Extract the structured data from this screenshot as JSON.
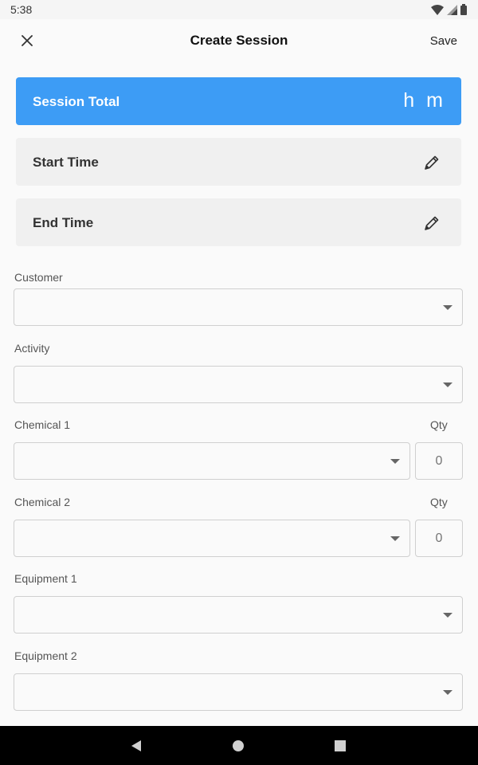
{
  "status": {
    "time": "5:38"
  },
  "appbar": {
    "title": "Create Session",
    "save_label": "Save"
  },
  "session_total": {
    "label": "Session Total",
    "hours_unit": "h",
    "minutes_unit": "m"
  },
  "start_time": {
    "label": "Start Time"
  },
  "end_time": {
    "label": "End Time"
  },
  "fields": {
    "customer": {
      "label": "Customer",
      "value": ""
    },
    "activity": {
      "label": "Activity",
      "value": ""
    },
    "chemical1": {
      "label": "Chemical 1",
      "value": "",
      "qty_label": "Qty",
      "qty_placeholder": "0"
    },
    "chemical2": {
      "label": "Chemical 2",
      "value": "",
      "qty_label": "Qty",
      "qty_placeholder": "0"
    },
    "equipment1": {
      "label": "Equipment 1",
      "value": ""
    },
    "equipment2": {
      "label": "Equipment 2",
      "value": ""
    }
  },
  "colors": {
    "accent": "#3d9cf5",
    "card_bg": "#f0f0f0",
    "nav_bg": "#000000"
  }
}
